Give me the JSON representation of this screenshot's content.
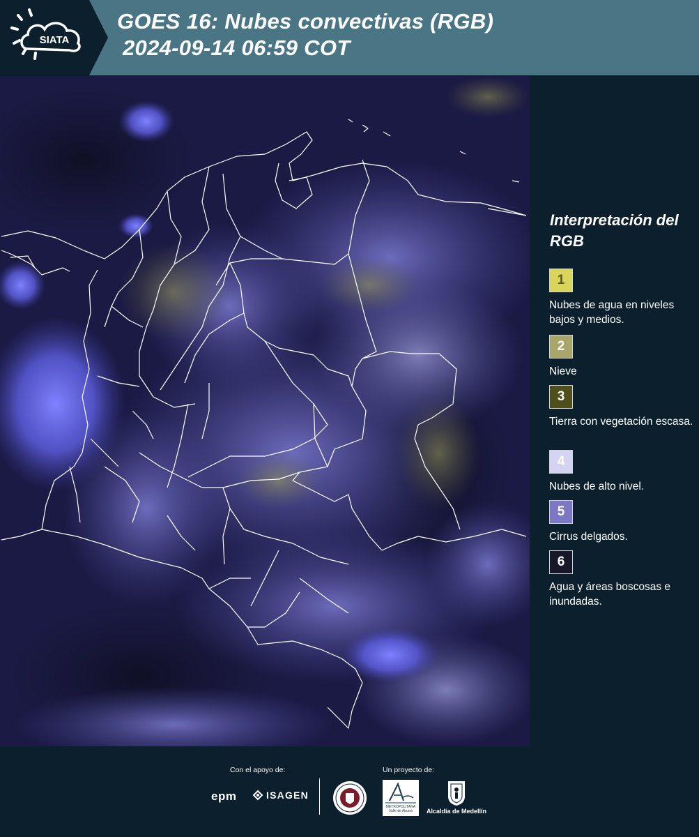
{
  "header": {
    "logo_text": "SIATA",
    "title_line1": "GOES 16: Nubes convectivas (RGB)",
    "title_line2": "2024-09-14 06:59 COT"
  },
  "legend": {
    "title": "Interpretación del RGB",
    "items": [
      {
        "number": "1",
        "label": "Nubes de agua en niveles bajos y medios.",
        "color": "#d9d45a",
        "text_color": "#5a5520"
      },
      {
        "number": "2",
        "label": "Nieve",
        "color": "#a9a66a",
        "text_color": "#ffffff"
      },
      {
        "number": "3",
        "label": "Tierra con vegetación escasa.",
        "color": "#4f4f1c",
        "text_color": "#ffffff"
      },
      {
        "number": "4",
        "label": "Nubes de alto nivel.",
        "color": "#d4d3f2",
        "text_color": "#ffffff"
      },
      {
        "number": "5",
        "label": "Cirrus delgados.",
        "color": "#7c78c4",
        "text_color": "#ffffff"
      },
      {
        "number": "6",
        "label": "Agua y áreas boscosas e inundadas.",
        "color": "#17172a",
        "text_color": "#ffffff"
      }
    ]
  },
  "footer": {
    "support_label": "Con el apoyo de:",
    "project_label": "Un proyecto de:",
    "sponsors": [
      "epm",
      "ISAGEN"
    ],
    "partners": [
      "Área Metropolitana Valle de Aburrá",
      "Alcaldía de Medellín"
    ],
    "area_logo_text": "METROPOLITANA Valle de Aburrá",
    "alcaldia_label": "Alcaldía de Medellín"
  },
  "colors": {
    "header_bg": "#4a7585",
    "page_bg": "#0b202c",
    "map_bg": "#1b1a45",
    "cloud_blue": "#5b5ad8"
  },
  "map": {
    "type": "satellite-rgb",
    "region": "Colombia",
    "boundaries": "white outlines of departments"
  }
}
